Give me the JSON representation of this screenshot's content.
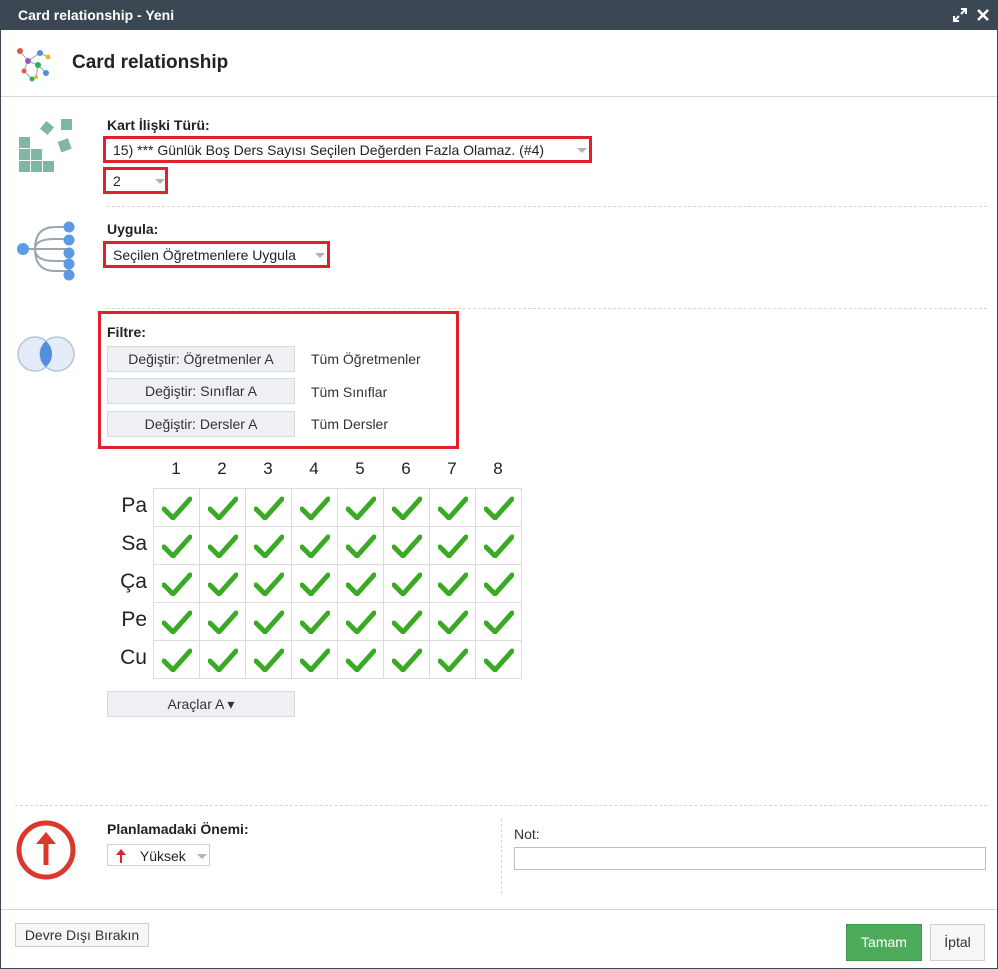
{
  "window": {
    "title": "Card relationship - Yeni"
  },
  "titlebar": {
    "maximize_icon": "maximize-icon",
    "close_icon": "close-icon"
  },
  "header": {
    "title": "Card relationship",
    "icon": "network-icon"
  },
  "relation": {
    "label": "Kart İlişki Türü:",
    "type_value": "15) *** Günlük Boş Ders Sayısı Seçilen Değerden Fazla Olamaz. (#4)",
    "count_value": "2",
    "icon": "cards-icon"
  },
  "apply": {
    "label": "Uygula:",
    "value": "Seçilen Öğretmenlere Uygula",
    "icon": "tree-icon"
  },
  "filter": {
    "label": "Filtre:",
    "icon": "venn-icon",
    "rows": [
      {
        "button": "Değiştir: Öğretmenler A",
        "text": "Tüm Öğretmenler"
      },
      {
        "button": "Değiştir: Sınıflar A",
        "text": "Tüm Sınıflar"
      },
      {
        "button": "Değiştir: Dersler A",
        "text": "Tüm Dersler"
      }
    ]
  },
  "grid": {
    "periods": [
      "1",
      "2",
      "3",
      "4",
      "5",
      "6",
      "7",
      "8"
    ],
    "days": [
      "Pa",
      "Sa",
      "Ça",
      "Pe",
      "Cu"
    ],
    "check_color": "#3aaa24"
  },
  "tools": {
    "button": "Araçlar A ▾"
  },
  "priority": {
    "label": "Planlamadaki Önemi:",
    "value": "Yüksek",
    "icon": "arrow-up-circle-icon",
    "color": "#d9382a"
  },
  "note": {
    "label": "Not:",
    "value": ""
  },
  "footer": {
    "disable_button": "Devre Dışı Bırakın",
    "ok_button": "Tamam",
    "cancel_button": "İptal"
  },
  "colors": {
    "titlebar": "#3b4752",
    "highlight": "#e0202a",
    "ok": "#4fab5c"
  }
}
